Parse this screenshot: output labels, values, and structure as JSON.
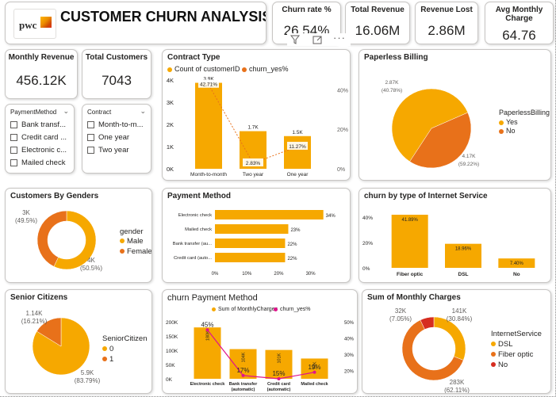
{
  "header": {
    "logo_text": "pwc",
    "title": "CUSTOMER CHURN ANALYSIS"
  },
  "kpis": {
    "churn_rate": {
      "label": "Churn rate %",
      "value": "26.54%"
    },
    "total_revenue": {
      "label": "Total Revenue",
      "value": "16.06M"
    },
    "revenue_lost": {
      "label": "Revenue Lost",
      "value": "2.86M"
    },
    "avg_monthly_charge": {
      "label": "Avg Monthly Charge",
      "value": "64.76"
    },
    "monthly_revenue": {
      "label": "Monthly Revenue",
      "value": "456.12K"
    },
    "total_customers": {
      "label": "Total Customers",
      "value": "7043"
    }
  },
  "visual_toolbar": {
    "filter_icon": "filter-icon",
    "focus_icon": "focus-mode-icon",
    "more_icon": "more-options-icon"
  },
  "slicers": {
    "payment_method": {
      "label": "PaymentMethod",
      "items": [
        "Bank transf...",
        "Credit card ...",
        "Electronic c...",
        "Mailed check"
      ]
    },
    "contract": {
      "label": "Contract",
      "items": [
        "Month-to-m...",
        "One year",
        "Two year"
      ]
    }
  },
  "colors": {
    "orange": "#f6a800",
    "dark_orange": "#e8711a",
    "red": "#d62d20",
    "magenta": "#e0148c"
  },
  "chart_data": [
    {
      "id": "contract_type",
      "type": "bar",
      "title": "Contract Type",
      "legend": [
        "Count of customerID",
        "churn_yes%"
      ],
      "categories": [
        "Month-to-month",
        "Two year",
        "One year"
      ],
      "series": [
        {
          "name": "Count of customerID",
          "values": [
            3875,
            1695,
            1473
          ],
          "labels": [
            "3.9K",
            "1.7K",
            "1.5K"
          ]
        },
        {
          "name": "churn_yes%",
          "values": [
            42.71,
            2.83,
            11.27
          ],
          "labels": [
            "42.71%",
            "2.83%",
            "11.27%"
          ]
        }
      ],
      "y_ticks": [
        "0K",
        "1K",
        "2K",
        "3K",
        "4K"
      ],
      "y2_ticks": [
        "0%",
        "20%",
        "40%"
      ],
      "ylim": [
        0,
        4000
      ],
      "y2lim": [
        0,
        45
      ]
    },
    {
      "id": "paperless_billing",
      "type": "pie",
      "title": "Paperless Billing",
      "legend_title": "PaperlessBilling",
      "slices": [
        {
          "name": "Yes",
          "value": 4170,
          "label": "4.17K (59.22%)"
        },
        {
          "name": "No",
          "value": 2870,
          "label": "2.87K (40.78%)"
        }
      ]
    },
    {
      "id": "gender",
      "type": "pie",
      "title": "Customers By Genders",
      "legend_title": "gender",
      "slices": [
        {
          "name": "Male",
          "value": 4000,
          "label": "4K (50.5%)"
        },
        {
          "name": "Female",
          "value": 3000,
          "label": "3K (49.5%)"
        }
      ]
    },
    {
      "id": "payment_method",
      "type": "bar",
      "title": "Payment Method",
      "categories": [
        "Electronic check",
        "Mailed check",
        "Bank transfer (au...",
        "Credit card (auto..."
      ],
      "values": [
        34,
        23,
        22,
        22
      ],
      "labels": [
        "34%",
        "23%",
        "22%",
        "22%"
      ],
      "x_ticks": [
        "0%",
        "10%",
        "20%",
        "30%"
      ],
      "xlim": [
        0,
        34
      ]
    },
    {
      "id": "internet_service",
      "type": "bar",
      "title": "churn by type of Internet Service",
      "categories": [
        "Fiber optic",
        "DSL",
        "No"
      ],
      "values": [
        41.89,
        18.96,
        7.4
      ],
      "labels": [
        "41.89%",
        "18.96%",
        "7.40%"
      ],
      "y_ticks": [
        "0%",
        "20%",
        "40%"
      ],
      "ylim": [
        0,
        45
      ]
    },
    {
      "id": "senior_citizens",
      "type": "pie",
      "title": "Senior Citizens",
      "legend_title": "SeniorCitizen",
      "slices": [
        {
          "name": "0",
          "value": 5900,
          "label": "5.9K (83.79%)"
        },
        {
          "name": "1",
          "value": 1140,
          "label": "1.14K (16.21%)"
        }
      ]
    },
    {
      "id": "churn_payment_method",
      "type": "bar",
      "title": "churn Payment Method",
      "legend": [
        "Sum of MonthlyCharges",
        "churn_yes%"
      ],
      "categories": [
        "Electronic check",
        "Bank transfer (automatic)",
        "Credit card (automatic)",
        "Mailed check"
      ],
      "series": [
        {
          "name": "Sum of MonthlyCharges",
          "values": [
            180000,
            104000,
            101000,
            71000
          ],
          "labels": [
            "180K",
            "104K",
            "101K",
            "71K"
          ]
        },
        {
          "name": "churn_yes%",
          "values": [
            45,
            17,
            15,
            19
          ],
          "labels": [
            "45%",
            "17%",
            "15%",
            "19%"
          ]
        }
      ],
      "y_ticks": [
        "0K",
        "50K",
        "100K",
        "150K",
        "200K"
      ],
      "y2_ticks": [
        "20%",
        "30%",
        "40%",
        "50%"
      ],
      "ylim": [
        0,
        200000
      ],
      "y2lim": [
        15,
        50
      ]
    },
    {
      "id": "monthly_charges",
      "type": "pie",
      "title": "Sum of Monthly Charges",
      "legend_title": "InternetService",
      "slices": [
        {
          "name": "DSL",
          "value": 141000,
          "label": "141K (30.84%)"
        },
        {
          "name": "Fiber optic",
          "value": 283000,
          "label": "283K (62.11%)"
        },
        {
          "name": "No",
          "value": 32000,
          "label": "32K (7.05%)"
        }
      ]
    }
  ]
}
